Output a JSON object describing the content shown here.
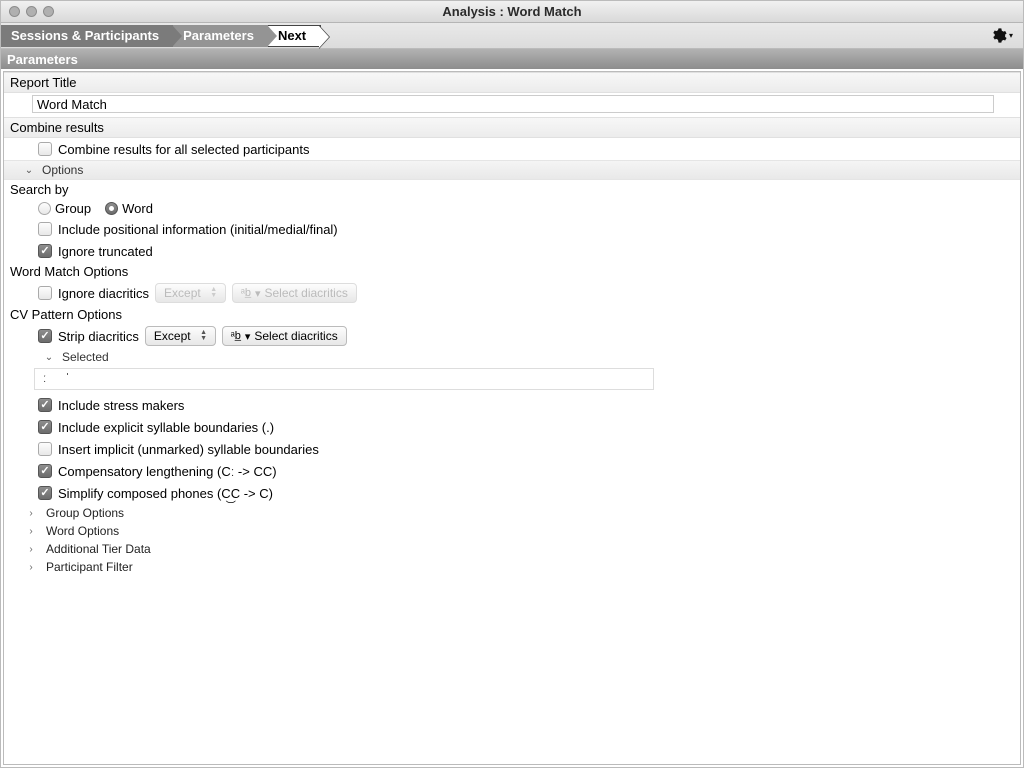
{
  "window": {
    "title": "Analysis : Word Match"
  },
  "breadcrumbs": {
    "step1": "Sessions & Participants",
    "step2": "Parameters",
    "step3": "Next"
  },
  "panel": {
    "title": "Parameters"
  },
  "report_title": {
    "label": "Report Title",
    "value": "Word Match"
  },
  "combine": {
    "label": "Combine results",
    "checkbox_label": "Combine results for all selected participants",
    "checked": false
  },
  "options_disclosure": "Options",
  "search_by": {
    "label": "Search by",
    "group_label": "Group",
    "word_label": "Word",
    "selected": "Word",
    "include_positional": {
      "label": "Include positional information (initial/medial/final)",
      "checked": false
    },
    "ignore_truncated": {
      "label": "Ignore truncated",
      "checked": true
    }
  },
  "word_match_options": {
    "label": "Word Match Options",
    "ignore_diacritics": {
      "label": "Ignore diacritics",
      "checked": false
    },
    "except_label": "Except",
    "select_diacritics_label": "Select diacritics"
  },
  "cv_pattern_options": {
    "label": "CV Pattern Options",
    "strip_diacritics": {
      "label": "Strip diacritics",
      "checked": true
    },
    "except_label": "Except",
    "select_diacritics_label": "Select diacritics",
    "selected_disclosure": "Selected",
    "selected_value": "ː    ˈ",
    "include_stress": {
      "label": "Include stress makers",
      "checked": true
    },
    "include_explicit_syll": {
      "label": "Include explicit syllable boundaries (.)",
      "checked": true
    },
    "insert_implicit_syll": {
      "label": "Insert implicit (unmarked) syllable boundaries",
      "checked": false
    },
    "comp_lengthening": {
      "label": "Compensatory lengthening (Cː -> CC)",
      "checked": true
    },
    "simplify_composed": {
      "label": "Simplify composed phones (C͜C -> C)",
      "checked": true
    }
  },
  "collapsed_sections": {
    "group_options": "Group Options",
    "word_options": "Word Options",
    "additional_tier": "Additional Tier Data",
    "participant_filter": "Participant Filter"
  }
}
